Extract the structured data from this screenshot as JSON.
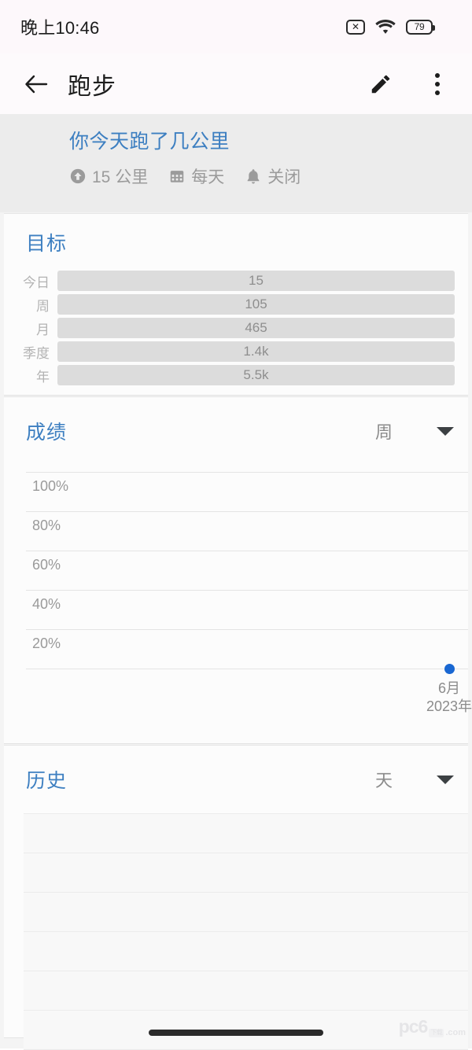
{
  "status_bar": {
    "time": "晚上10:46",
    "mute_icon": "mute-icon",
    "wifi_icon": "wifi-icon",
    "battery_icon": "battery-icon",
    "battery_level": "79"
  },
  "app_bar": {
    "back_icon": "back-arrow-icon",
    "title": "跑步",
    "edit_icon": "pencil-icon",
    "overflow_icon": "more-vertical-icon"
  },
  "summary": {
    "title": "你今天跑了几公里",
    "meta": [
      {
        "icon": "arrow-up-circle-icon",
        "label": "15 公里"
      },
      {
        "icon": "calendar-icon",
        "label": "每天"
      },
      {
        "icon": "bell-icon",
        "label": "关闭"
      }
    ]
  },
  "goals_card": {
    "title": "目标",
    "rows": [
      {
        "label": "今日",
        "value": "15"
      },
      {
        "label": "周",
        "value": "105"
      },
      {
        "label": "月",
        "value": "465"
      },
      {
        "label": "季度",
        "value": "1.4k"
      },
      {
        "label": "年",
        "value": "5.5k"
      }
    ]
  },
  "chart_card": {
    "title": "成绩",
    "select_value": "周",
    "caret_icon": "chevron-down-icon"
  },
  "history_card": {
    "title": "历史",
    "select_value": "天",
    "caret_icon": "chevron-down-icon",
    "rows": [
      "",
      "",
      "",
      "",
      "",
      ""
    ]
  },
  "watermark": {
    "main": "pc6",
    "badge": "下载",
    "domain": ".com"
  },
  "colors": {
    "accent_blue": "#3d7fc1",
    "data_point_blue": "#1967d2",
    "goal_bar_gray": "#dcdcdc",
    "summary_band_gray": "#ececec",
    "status_bar_bg": "#fdf8fb"
  },
  "chart_data": {
    "type": "line",
    "title": "成绩",
    "xlabel": "",
    "ylabel": "",
    "ylim": [
      0,
      110
    ],
    "grid": true,
    "legend": "none",
    "ytick_labels": [
      "100%",
      "80%",
      "60%",
      "40%",
      "20%"
    ],
    "ytick_values": [
      100,
      80,
      60,
      40,
      20
    ],
    "x": [
      "6月\n2023年"
    ],
    "xtick_labels": [
      [
        "6月",
        "2023年"
      ]
    ],
    "series": [
      {
        "name": "成绩",
        "values": [
          0
        ],
        "color": "#1967d2",
        "marker": "circle"
      }
    ]
  }
}
